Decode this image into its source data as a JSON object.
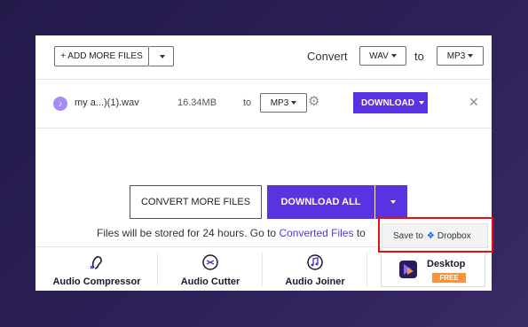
{
  "toolbar": {
    "add_files_label": "+ ADD MORE FILES",
    "convert_label": "Convert",
    "from_format": "WAV",
    "to_label": "to",
    "to_format": "MP3"
  },
  "file": {
    "name": "my a...)(1).wav",
    "size": "16.34MB",
    "to_label": "to",
    "format": "MP3",
    "download_label": "DOWNLOAD"
  },
  "actions": {
    "convert_more_label": "CONVERT MORE FILES",
    "download_all_label": "DOWNLOAD ALL"
  },
  "storage_note": {
    "before": "Files will be stored for 24 hours. Go to ",
    "link": "Converted Files",
    "after": " to"
  },
  "tools": [
    {
      "label": "Audio Compressor",
      "icon": "audio-compressor-icon"
    },
    {
      "label": "Audio Cutter",
      "icon": "audio-cutter-icon"
    },
    {
      "label": "Audio Joiner",
      "icon": "audio-joiner-icon"
    }
  ],
  "desktop": {
    "label": "Desktop",
    "badge": "FREE"
  },
  "dropdown": {
    "save_label": "Save to",
    "service": "Dropbox"
  },
  "colors": {
    "accent": "#5a33e0",
    "highlight": "#e3120b",
    "badge": "#f5943a"
  }
}
